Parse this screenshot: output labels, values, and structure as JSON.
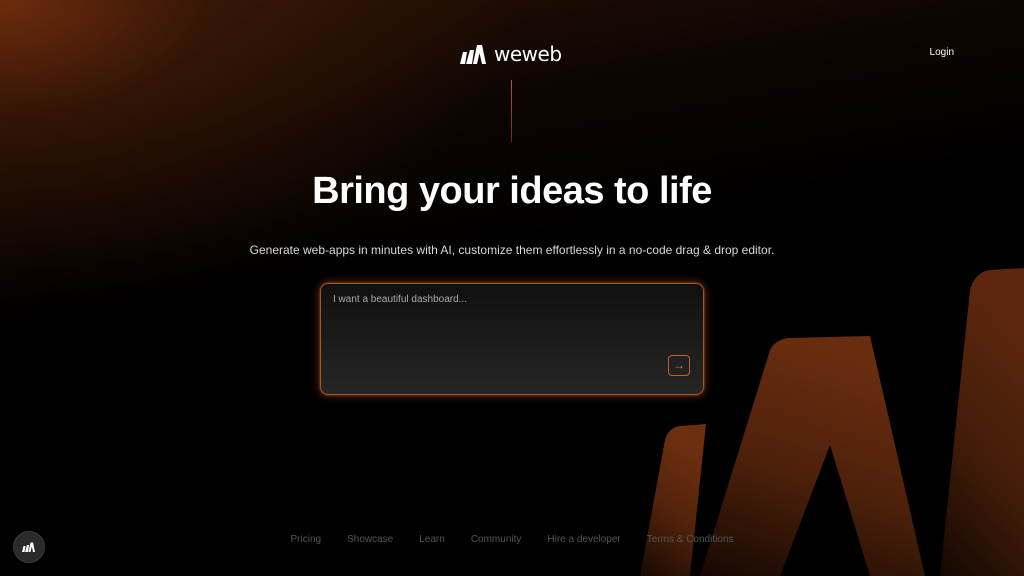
{
  "brand": {
    "name": "weweb",
    "logo_icon": "weweb-logo-icon",
    "accent": "#c0602e"
  },
  "header": {
    "login_label": "Login"
  },
  "hero": {
    "title": "Bring your ideas to life",
    "subtitle": "Generate web-apps in minutes with AI, customize them effortlessly in a no-code drag & drop editor."
  },
  "prompt": {
    "placeholder": "I want a beautiful dashboard...",
    "value": "",
    "submit_icon": "arrow-right-icon",
    "submit_glyph": "→"
  },
  "footer": {
    "links": [
      "Pricing",
      "Showcase",
      "Learn",
      "Community",
      "Hire a developer",
      "Terms & Conditions"
    ]
  },
  "floating_badge": {
    "icon": "weweb-logo-icon"
  }
}
